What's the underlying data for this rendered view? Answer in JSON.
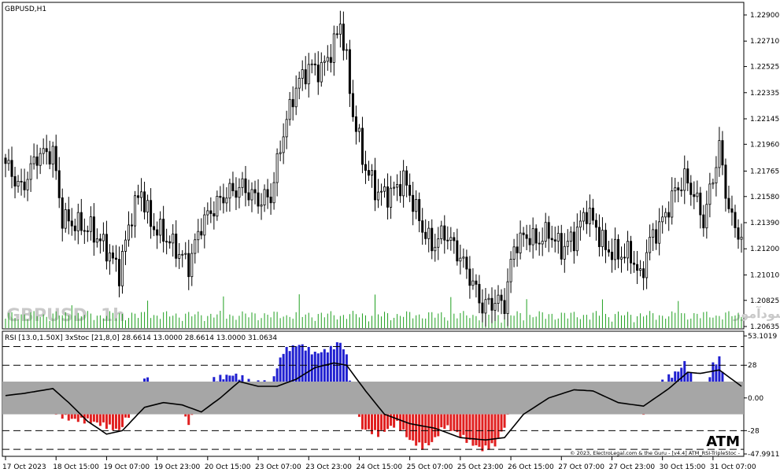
{
  "header": {
    "symbol_label": "GBPUSD,H1"
  },
  "watermark": {
    "pair": "GBPUSD",
    "timeframe": "1h",
    "site_text": "انتشار در سایت سودآموز"
  },
  "indicator": {
    "title": "RSI [13.0,1.50X] 3xStoc [21,8,0] 28.6614 13.0000 28.6614 13.0000 31.0634",
    "brand": "ATM",
    "copyright": "© 2023, ElectroLegal.com & the Guru - [v4.4] ATM_RSI-TripleStoc -",
    "scale_labels": [
      "53.1019",
      "28",
      "0.00",
      "-28",
      "-47.9911"
    ],
    "scale_values": [
      53.1019,
      28,
      0,
      -28,
      -47.9911
    ],
    "levels": [
      44,
      28,
      -28,
      -44
    ],
    "gray_band": [
      -14,
      14
    ]
  },
  "price_axis": {
    "labels": [
      "1.22900",
      "1.22710",
      "1.22525",
      "1.22335",
      "1.22145",
      "1.21960",
      "1.21765",
      "1.21580",
      "1.21390",
      "1.21200",
      "1.21010",
      "1.20825",
      "1.20635"
    ],
    "values": [
      1.229,
      1.2271,
      1.22525,
      1.22335,
      1.22145,
      1.2196,
      1.21765,
      1.2158,
      1.2139,
      1.212,
      1.2101,
      1.20825,
      1.20635
    ]
  },
  "time_axis": {
    "labels": [
      "17 Oct 2023",
      "18 Oct 15:00",
      "19 Oct 07:00",
      "19 Oct 23:00",
      "20 Oct 15:00",
      "23 Oct 07:00",
      "23 Oct 23:00",
      "24 Oct 15:00",
      "25 Oct 07:00",
      "25 Oct 23:00",
      "26 Oct 15:00",
      "27 Oct 07:00",
      "27 Oct 23:00",
      "30 Oct 15:00",
      "31 Oct 07:00"
    ]
  },
  "colors": {
    "bull": "#2020d0",
    "bear": "#e02020",
    "volume": "#20a020",
    "band": "#a6a6a6",
    "candle": "#000000"
  },
  "chart_data": [
    {
      "type": "candlestick",
      "title": "GBPUSD,H1",
      "x_labels": [
        "17 Oct 2023",
        "18 Oct 15:00",
        "19 Oct 07:00",
        "19 Oct 23:00",
        "20 Oct 15:00",
        "23 Oct 07:00",
        "23 Oct 23:00",
        "24 Oct 15:00",
        "25 Oct 07:00",
        "25 Oct 23:00",
        "26 Oct 15:00",
        "27 Oct 07:00",
        "27 Oct 23:00",
        "30 Oct 15:00",
        "31 Oct 07:00"
      ],
      "close_anchors": [
        {
          "bar": 0,
          "close": 1.2182
        },
        {
          "bar": 5,
          "close": 1.2163
        },
        {
          "bar": 10,
          "close": 1.2188
        },
        {
          "bar": 15,
          "close": 1.219
        },
        {
          "bar": 18,
          "close": 1.2142
        },
        {
          "bar": 22,
          "close": 1.2138
        },
        {
          "bar": 27,
          "close": 1.2134
        },
        {
          "bar": 32,
          "close": 1.212
        },
        {
          "bar": 36,
          "close": 1.2103
        },
        {
          "bar": 40,
          "close": 1.2146
        },
        {
          "bar": 43,
          "close": 1.2162
        },
        {
          "bar": 46,
          "close": 1.2138
        },
        {
          "bar": 50,
          "close": 1.213
        },
        {
          "bar": 54,
          "close": 1.212
        },
        {
          "bar": 58,
          "close": 1.2108
        },
        {
          "bar": 62,
          "close": 1.2138
        },
        {
          "bar": 66,
          "close": 1.215
        },
        {
          "bar": 70,
          "close": 1.216
        },
        {
          "bar": 75,
          "close": 1.2165
        },
        {
          "bar": 80,
          "close": 1.2155
        },
        {
          "bar": 84,
          "close": 1.2158
        },
        {
          "bar": 88,
          "close": 1.2205
        },
        {
          "bar": 92,
          "close": 1.2238
        },
        {
          "bar": 96,
          "close": 1.2252
        },
        {
          "bar": 100,
          "close": 1.225
        },
        {
          "bar": 104,
          "close": 1.2268
        },
        {
          "bar": 106,
          "close": 1.2285
        },
        {
          "bar": 108,
          "close": 1.2255
        },
        {
          "bar": 110,
          "close": 1.2218
        },
        {
          "bar": 114,
          "close": 1.2178
        },
        {
          "bar": 118,
          "close": 1.216
        },
        {
          "bar": 122,
          "close": 1.216
        },
        {
          "bar": 126,
          "close": 1.217
        },
        {
          "bar": 128,
          "close": 1.216
        },
        {
          "bar": 132,
          "close": 1.2135
        },
        {
          "bar": 135,
          "close": 1.2122
        },
        {
          "bar": 139,
          "close": 1.2132
        },
        {
          "bar": 143,
          "close": 1.2118
        },
        {
          "bar": 147,
          "close": 1.21
        },
        {
          "bar": 151,
          "close": 1.2078
        },
        {
          "bar": 155,
          "close": 1.2082
        },
        {
          "bar": 158,
          "close": 1.208
        },
        {
          "bar": 161,
          "close": 1.2122
        },
        {
          "bar": 165,
          "close": 1.213
        },
        {
          "bar": 168,
          "close": 1.2125
        },
        {
          "bar": 172,
          "close": 1.2132
        },
        {
          "bar": 176,
          "close": 1.212
        },
        {
          "bar": 180,
          "close": 1.2128
        },
        {
          "bar": 184,
          "close": 1.2148
        },
        {
          "bar": 187,
          "close": 1.2135
        },
        {
          "bar": 190,
          "close": 1.212
        },
        {
          "bar": 194,
          "close": 1.2116
        },
        {
          "bar": 198,
          "close": 1.2116
        },
        {
          "bar": 201,
          "close": 1.2098
        },
        {
          "bar": 204,
          "close": 1.2126
        },
        {
          "bar": 208,
          "close": 1.214
        },
        {
          "bar": 212,
          "close": 1.2162
        },
        {
          "bar": 215,
          "close": 1.2171
        },
        {
          "bar": 218,
          "close": 1.216
        },
        {
          "bar": 221,
          "close": 1.214
        },
        {
          "bar": 224,
          "close": 1.2172
        },
        {
          "bar": 226,
          "close": 1.2194
        },
        {
          "bar": 228,
          "close": 1.2162
        },
        {
          "bar": 230,
          "close": 1.214
        },
        {
          "bar": 233,
          "close": 1.2128
        }
      ],
      "price_min": 1.20635,
      "price_max": 1.229,
      "bars": 234
    },
    {
      "type": "area",
      "title": "RSI [13.0,1.50X] 3xStoc [21,8,0] 28.6614 13.0000 28.6614 13.0000 31.0634",
      "ylim": [
        -47.9911,
        53.1019
      ],
      "levels": [
        44,
        28,
        -28,
        -44
      ],
      "histogram_anchors": [
        {
          "bar": 0,
          "value": 0
        },
        {
          "bar": 12,
          "value": -7
        },
        {
          "bar": 20,
          "value": -18
        },
        {
          "bar": 27,
          "value": -20
        },
        {
          "bar": 32,
          "value": -24
        },
        {
          "bar": 36,
          "value": -28
        },
        {
          "bar": 40,
          "value": -10
        },
        {
          "bar": 44,
          "value": 18
        },
        {
          "bar": 48,
          "value": 8
        },
        {
          "bar": 56,
          "value": -10
        },
        {
          "bar": 58,
          "value": -22
        },
        {
          "bar": 62,
          "value": 0
        },
        {
          "bar": 66,
          "value": 16
        },
        {
          "bar": 72,
          "value": 20
        },
        {
          "bar": 78,
          "value": 14
        },
        {
          "bar": 84,
          "value": 12
        },
        {
          "bar": 88,
          "value": 40
        },
        {
          "bar": 93,
          "value": 46
        },
        {
          "bar": 98,
          "value": 38
        },
        {
          "bar": 103,
          "value": 42
        },
        {
          "bar": 106,
          "value": 48
        },
        {
          "bar": 108,
          "value": 36
        },
        {
          "bar": 110,
          "value": -2
        },
        {
          "bar": 113,
          "value": -26
        },
        {
          "bar": 118,
          "value": -31
        },
        {
          "bar": 124,
          "value": -22
        },
        {
          "bar": 128,
          "value": -36
        },
        {
          "bar": 132,
          "value": -42
        },
        {
          "bar": 135,
          "value": -38
        },
        {
          "bar": 139,
          "value": -24
        },
        {
          "bar": 143,
          "value": -30
        },
        {
          "bar": 147,
          "value": -38
        },
        {
          "bar": 151,
          "value": -44
        },
        {
          "bar": 155,
          "value": -40
        },
        {
          "bar": 158,
          "value": -24
        },
        {
          "bar": 162,
          "value": 6
        },
        {
          "bar": 166,
          "value": 10
        },
        {
          "bar": 172,
          "value": 4
        },
        {
          "bar": 176,
          "value": 0
        },
        {
          "bar": 180,
          "value": 11
        },
        {
          "bar": 188,
          "value": 8
        },
        {
          "bar": 196,
          "value": -2
        },
        {
          "bar": 202,
          "value": -12
        },
        {
          "bar": 205,
          "value": 8
        },
        {
          "bar": 209,
          "value": 16
        },
        {
          "bar": 213,
          "value": 23
        },
        {
          "bar": 215,
          "value": 30
        },
        {
          "bar": 218,
          "value": 14
        },
        {
          "bar": 221,
          "value": 4
        },
        {
          "bar": 224,
          "value": 28
        },
        {
          "bar": 226,
          "value": 34
        },
        {
          "bar": 228,
          "value": 12
        },
        {
          "bar": 233,
          "value": -8
        }
      ],
      "signal_anchors": [
        {
          "bar": 0,
          "value": 2
        },
        {
          "bar": 6,
          "value": 4
        },
        {
          "bar": 15,
          "value": 8
        },
        {
          "bar": 20,
          "value": -4
        },
        {
          "bar": 26,
          "value": -20
        },
        {
          "bar": 32,
          "value": -31
        },
        {
          "bar": 37,
          "value": -28
        },
        {
          "bar": 44,
          "value": -8
        },
        {
          "bar": 50,
          "value": -4
        },
        {
          "bar": 56,
          "value": -6
        },
        {
          "bar": 62,
          "value": -12
        },
        {
          "bar": 68,
          "value": 0
        },
        {
          "bar": 74,
          "value": 14
        },
        {
          "bar": 80,
          "value": 10
        },
        {
          "bar": 86,
          "value": 10
        },
        {
          "bar": 92,
          "value": 16
        },
        {
          "bar": 98,
          "value": 26
        },
        {
          "bar": 104,
          "value": 30
        },
        {
          "bar": 108,
          "value": 28
        },
        {
          "bar": 114,
          "value": 6
        },
        {
          "bar": 120,
          "value": -14
        },
        {
          "bar": 128,
          "value": -22
        },
        {
          "bar": 136,
          "value": -26
        },
        {
          "bar": 144,
          "value": -34
        },
        {
          "bar": 152,
          "value": -36
        },
        {
          "bar": 158,
          "value": -34
        },
        {
          "bar": 164,
          "value": -14
        },
        {
          "bar": 172,
          "value": 0
        },
        {
          "bar": 180,
          "value": 7
        },
        {
          "bar": 186,
          "value": 6
        },
        {
          "bar": 194,
          "value": -4
        },
        {
          "bar": 202,
          "value": -7
        },
        {
          "bar": 210,
          "value": 8
        },
        {
          "bar": 216,
          "value": 22
        },
        {
          "bar": 220,
          "value": 21
        },
        {
          "bar": 226,
          "value": 24
        },
        {
          "bar": 233,
          "value": 10
        }
      ]
    }
  ]
}
